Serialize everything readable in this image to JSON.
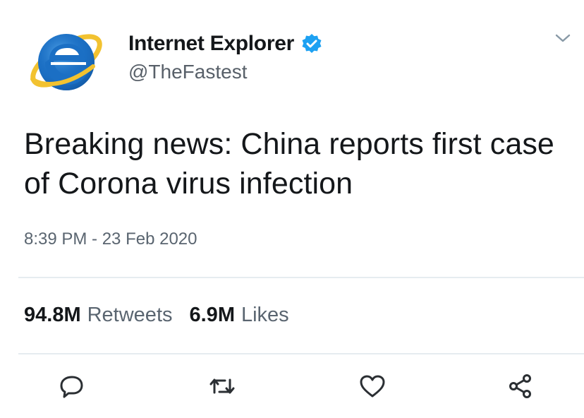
{
  "header": {
    "display_name": "Internet Explorer",
    "handle": "@TheFastest",
    "verified": true,
    "avatar_icon": "internet-explorer-logo-icon",
    "menu_icon": "chevron-down-icon"
  },
  "tweet": {
    "text": "Breaking news: China reports first case of Corona virus infection",
    "timestamp": "8:39 PM - 23 Feb 2020"
  },
  "stats": {
    "retweets_count": "94.8M",
    "retweets_label": "Retweets",
    "likes_count": "6.9M",
    "likes_label": "Likes"
  },
  "actions": [
    {
      "name": "reply",
      "icon": "speech-bubble-icon"
    },
    {
      "name": "retweet",
      "icon": "retweet-icon"
    },
    {
      "name": "like",
      "icon": "heart-icon"
    },
    {
      "name": "share",
      "icon": "share-icon"
    }
  ],
  "colors": {
    "text_primary": "#14171a",
    "text_secondary": "#5a6570",
    "verified_blue": "#1da1f2",
    "divider": "#e6ecf0",
    "ie_blue": "#1b6fc4",
    "ie_gold": "#f2c230"
  }
}
